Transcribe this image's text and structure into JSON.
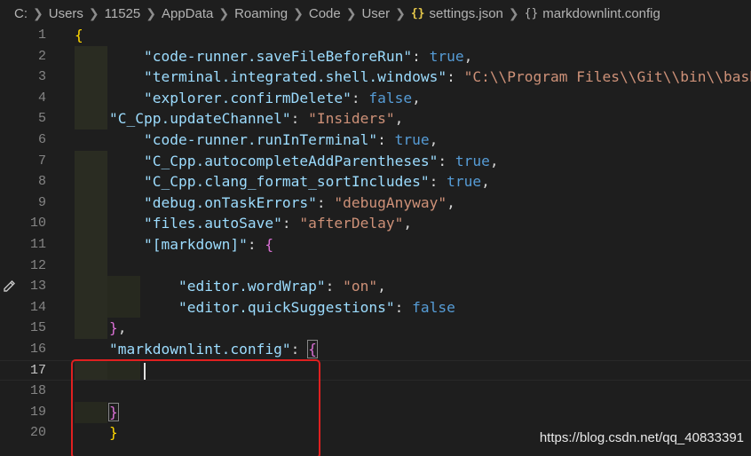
{
  "breadcrumb": {
    "items": [
      "C:",
      "Users",
      "11525",
      "AppData",
      "Roaming",
      "Code",
      "User"
    ],
    "file_icon": "{}",
    "file_name": "settings.json",
    "property_icon": "{}",
    "property_name": "markdownlint.config"
  },
  "gutter": {
    "line_numbers": [
      "1",
      "2",
      "3",
      "4",
      "5",
      "6",
      "7",
      "8",
      "9",
      "10",
      "11",
      "12",
      "13",
      "14",
      "15",
      "16",
      "17",
      "18",
      "19",
      "20"
    ]
  },
  "code": {
    "l1_brace": "{",
    "l2_key": "\"code-runner.saveFileBeforeRun\"",
    "l2_val": "true",
    "l3_key": "\"terminal.integrated.shell.windows\"",
    "l3_val": "\"C:\\\\Program Files\\\\Git\\\\bin\\\\bash",
    "l4_key": "\"explorer.confirmDelete\"",
    "l4_val": "false",
    "l5_key": "\"C_Cpp.updateChannel\"",
    "l5_val": "\"Insiders\"",
    "l6_key": "\"code-runner.runInTerminal\"",
    "l6_val": "true",
    "l7_key": "\"C_Cpp.autocompleteAddParentheses\"",
    "l7_val": "true",
    "l8_key": "\"C_Cpp.clang_format_sortIncludes\"",
    "l8_val": "true",
    "l9_key": "\"debug.onTaskErrors\"",
    "l9_val": "\"debugAnyway\"",
    "l10_key": "\"files.autoSave\"",
    "l10_val": "\"afterDelay\"",
    "l11_key": "\"[markdown]\"",
    "l11_brace": "{",
    "l13_key": "\"editor.wordWrap\"",
    "l13_val": "\"on\"",
    "l14_key": "\"editor.quickSuggestions\"",
    "l14_val": "false",
    "l15_brace": "}",
    "l16_key": "\"markdownlint.config\"",
    "l16_brace": "{",
    "l19_brace": "}",
    "l20_brace": "}"
  },
  "watermark": "https://blog.csdn.net/qq_40833391",
  "colors": {
    "background": "#1e1e1e",
    "key": "#9cdcfe",
    "string": "#ce9178",
    "boolean": "#569cd6",
    "bracket_level1": "#ffd700",
    "bracket_level2": "#da70d6",
    "highlight_box": "#e02020"
  },
  "icons": {
    "glyph_margin": "pencil-icon",
    "breadcrumb_separator": "chevron-right-icon"
  }
}
